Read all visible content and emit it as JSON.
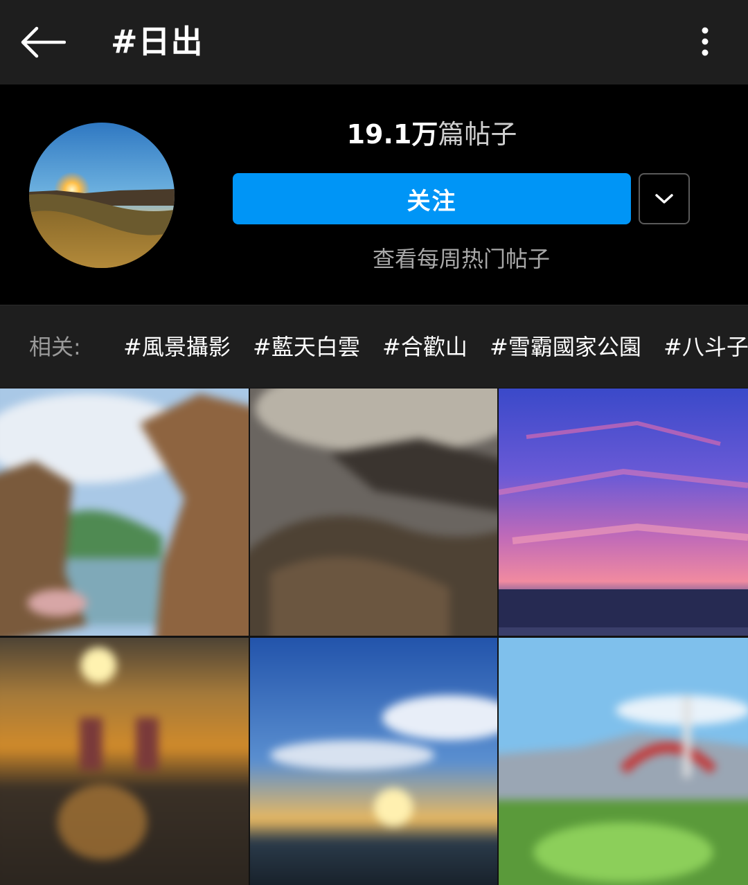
{
  "header": {
    "title": "#日出",
    "back_icon": "arrow-left-icon",
    "more_icon": "more-vertical-icon"
  },
  "profile": {
    "post_count": "19.1万",
    "post_unit": "篇帖子",
    "follow_label": "关注",
    "dropdown_icon": "chevron-down-icon",
    "weekly_link": "查看每周热门帖子"
  },
  "related": {
    "label": "相关:",
    "tags": [
      "#風景攝影",
      "#藍天白雲",
      "#合歡山",
      "#雪霸國家公園",
      "#八斗子"
    ]
  },
  "grid": {
    "posts": [
      {
        "name": "post-rock-arch-lake"
      },
      {
        "name": "post-cliff-clouds"
      },
      {
        "name": "post-pink-sky-sea"
      },
      {
        "name": "post-sunset-beach-figures"
      },
      {
        "name": "post-blue-sky-sunrise"
      },
      {
        "name": "post-bridge-greenery"
      }
    ]
  },
  "colors": {
    "accent": "#0095f6",
    "topbar": "#1e1e1e",
    "header_bg": "#000000",
    "muted_text": "#a8a8a8"
  }
}
